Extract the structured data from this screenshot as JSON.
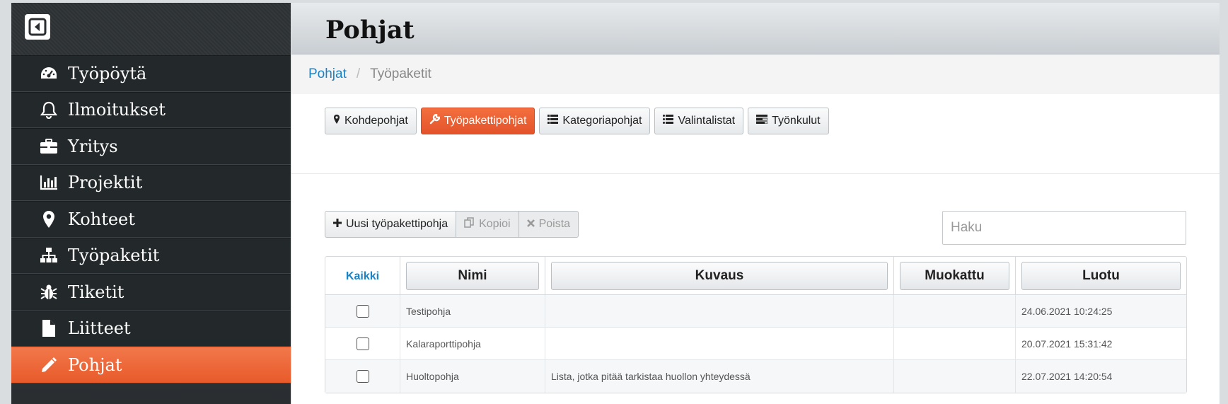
{
  "sidebar": {
    "items": [
      {
        "label": "Työpöytä",
        "icon": "dashboard-icon",
        "active": false
      },
      {
        "label": "Ilmoitukset",
        "icon": "bell-icon",
        "active": false
      },
      {
        "label": "Yritys",
        "icon": "briefcase-icon",
        "active": false
      },
      {
        "label": "Projektit",
        "icon": "bar-chart-icon",
        "active": false
      },
      {
        "label": "Kohteet",
        "icon": "map-marker-icon",
        "active": false
      },
      {
        "label": "Työpaketit",
        "icon": "sitemap-icon",
        "active": false
      },
      {
        "label": "Tiketit",
        "icon": "bug-icon",
        "active": false
      },
      {
        "label": "Liitteet",
        "icon": "file-icon",
        "active": false
      },
      {
        "label": "Pohjat",
        "icon": "pencil-icon",
        "active": true
      }
    ]
  },
  "header": {
    "title": "Pohjat"
  },
  "breadcrumb": {
    "root": "Pohjat",
    "separator": "/",
    "current": "Työpaketit"
  },
  "tabs": [
    {
      "label": "Kohdepohjat",
      "icon": "map-marker-icon",
      "active": false
    },
    {
      "label": "Työpakettipohjat",
      "icon": "wrench-icon",
      "active": true
    },
    {
      "label": "Kategoriapohjat",
      "icon": "list-icon",
      "active": false
    },
    {
      "label": "Valintalistat",
      "icon": "list-ul-icon",
      "active": false
    },
    {
      "label": "Työnkulut",
      "icon": "tasks-icon",
      "active": false
    }
  ],
  "actions": {
    "new_label": "Uusi työpakettipohja",
    "copy_label": "Kopioi",
    "delete_label": "Poista"
  },
  "search": {
    "placeholder": "Haku",
    "value": ""
  },
  "table": {
    "select_all": "Kaikki",
    "columns": [
      "Nimi",
      "Kuvaus",
      "Muokattu",
      "Luotu"
    ],
    "rows": [
      {
        "name": "Testipohja",
        "description": "",
        "modified": "",
        "created": "24.06.2021 10:24:25"
      },
      {
        "name": "Kalaraporttipohja",
        "description": "",
        "modified": "",
        "created": "20.07.2021 15:31:42"
      },
      {
        "name": "Huoltopohja",
        "description": "Lista, jotka pitää tarkistaa huollon yhteydessä",
        "modified": "",
        "created": "22.07.2021 14:20:54"
      }
    ]
  },
  "colors": {
    "accent": "#e85a2a",
    "link": "#1a82c5",
    "sidebar": "#23282b"
  }
}
